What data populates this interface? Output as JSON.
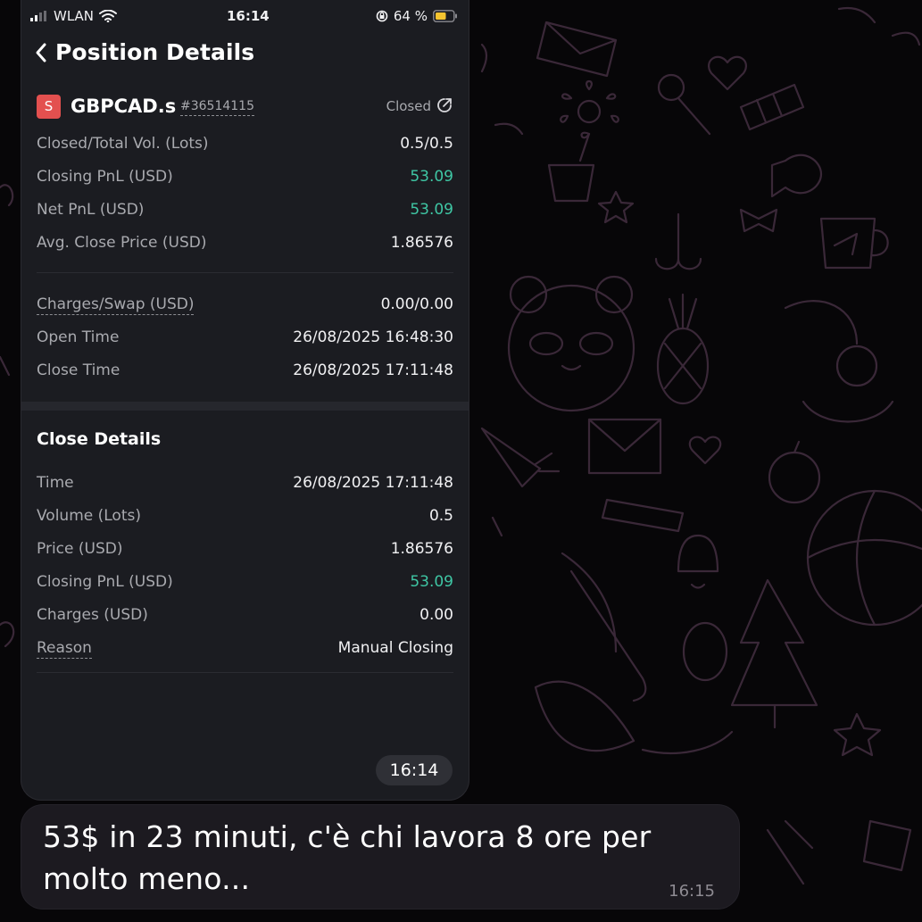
{
  "status_bar": {
    "carrier": "WLAN",
    "time": "16:14",
    "battery_percent": "64 %",
    "icons": [
      "signal-icon",
      "wifi-icon",
      "rotation-lock-icon",
      "battery-icon"
    ]
  },
  "header": {
    "title": "Position Details",
    "back_icon": "chevron-left-icon"
  },
  "position": {
    "badge": "S",
    "symbol": "GBPCAD.s",
    "id": "#36514115",
    "status": "Closed",
    "summary_rows": [
      {
        "label": "Closed/Total Vol. (Lots)",
        "value": "0.5/0.5"
      },
      {
        "label": "Closing PnL (USD)",
        "value": "53.09"
      },
      {
        "label": "Net PnL (USD)",
        "value": "53.09"
      },
      {
        "label": "Avg. Close Price (USD)",
        "value": "1.86576"
      }
    ],
    "detail_rows": [
      {
        "label": "Charges/Swap (USD)",
        "value": "0.00/0.00"
      },
      {
        "label": "Open Time",
        "value": "26/08/2025 16:48:30"
      },
      {
        "label": "Close Time",
        "value": "26/08/2025 17:11:48"
      }
    ]
  },
  "close_details": {
    "title": "Close Details",
    "rows": [
      {
        "label": "Time",
        "value": "26/08/2025 17:11:48"
      },
      {
        "label": "Volume (Lots)",
        "value": "0.5"
      },
      {
        "label": "Price (USD)",
        "value": "1.86576"
      },
      {
        "label": "Closing PnL (USD)",
        "value": "53.09"
      },
      {
        "label": "Charges (USD)",
        "value": "0.00"
      },
      {
        "label": "Reason",
        "value": "Manual Closing"
      }
    ]
  },
  "chat": {
    "screenshot_timestamp": "16:14",
    "message_text": "53$ in 23 minuti, c'è chi lavora 8 ore per molto meno...",
    "message_timestamp": "16:15"
  },
  "colors": {
    "profit_green": "#3fc6a4",
    "sell_badge_red": "#e3504f",
    "card_background": "#1b1c21",
    "chat_background": "#070608",
    "doodle_stroke": "#3a2838"
  }
}
